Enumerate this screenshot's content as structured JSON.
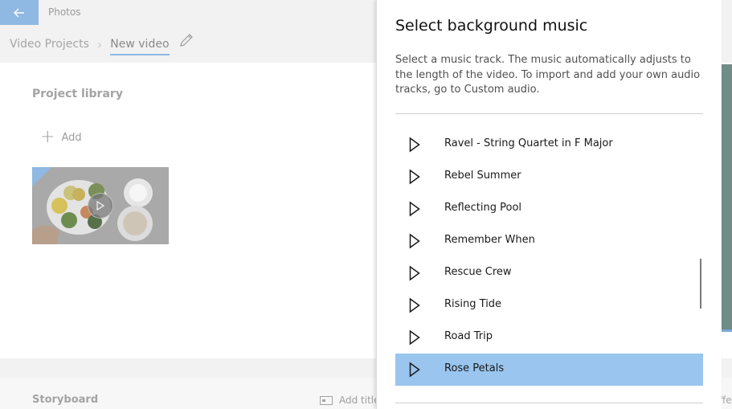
{
  "app": {
    "title": "Photos",
    "breadcrumb": {
      "root": "Video Projects",
      "separator": "›",
      "current": "New video"
    },
    "library": {
      "title": "Project library",
      "add_label": "Add"
    },
    "storyboard": {
      "title": "Storyboard",
      "add_title_label": "Add title",
      "effects_partial": "ffe"
    }
  },
  "panel": {
    "title": "Select background music",
    "description": "Select a music track. The music automatically adjusts to the length of the video. To import and add your own audio tracks, go to Custom audio.",
    "tracks": [
      {
        "name": "Ravel - String Quartet in F Major",
        "selected": false
      },
      {
        "name": "Rebel Summer",
        "selected": false
      },
      {
        "name": "Reflecting Pool",
        "selected": false
      },
      {
        "name": "Remember When",
        "selected": false
      },
      {
        "name": "Rescue Crew",
        "selected": false
      },
      {
        "name": "Rising Tide",
        "selected": false
      },
      {
        "name": "Road Trip",
        "selected": false
      },
      {
        "name": "Rose Petals",
        "selected": true
      }
    ]
  },
  "colors": {
    "accent": "#8fb8e3",
    "selected_row": "#99c5ef"
  },
  "icons": {
    "back": "back-arrow-icon",
    "edit": "pencil-icon",
    "add": "plus-icon",
    "play": "play-icon",
    "title_card": "title-card-icon"
  }
}
